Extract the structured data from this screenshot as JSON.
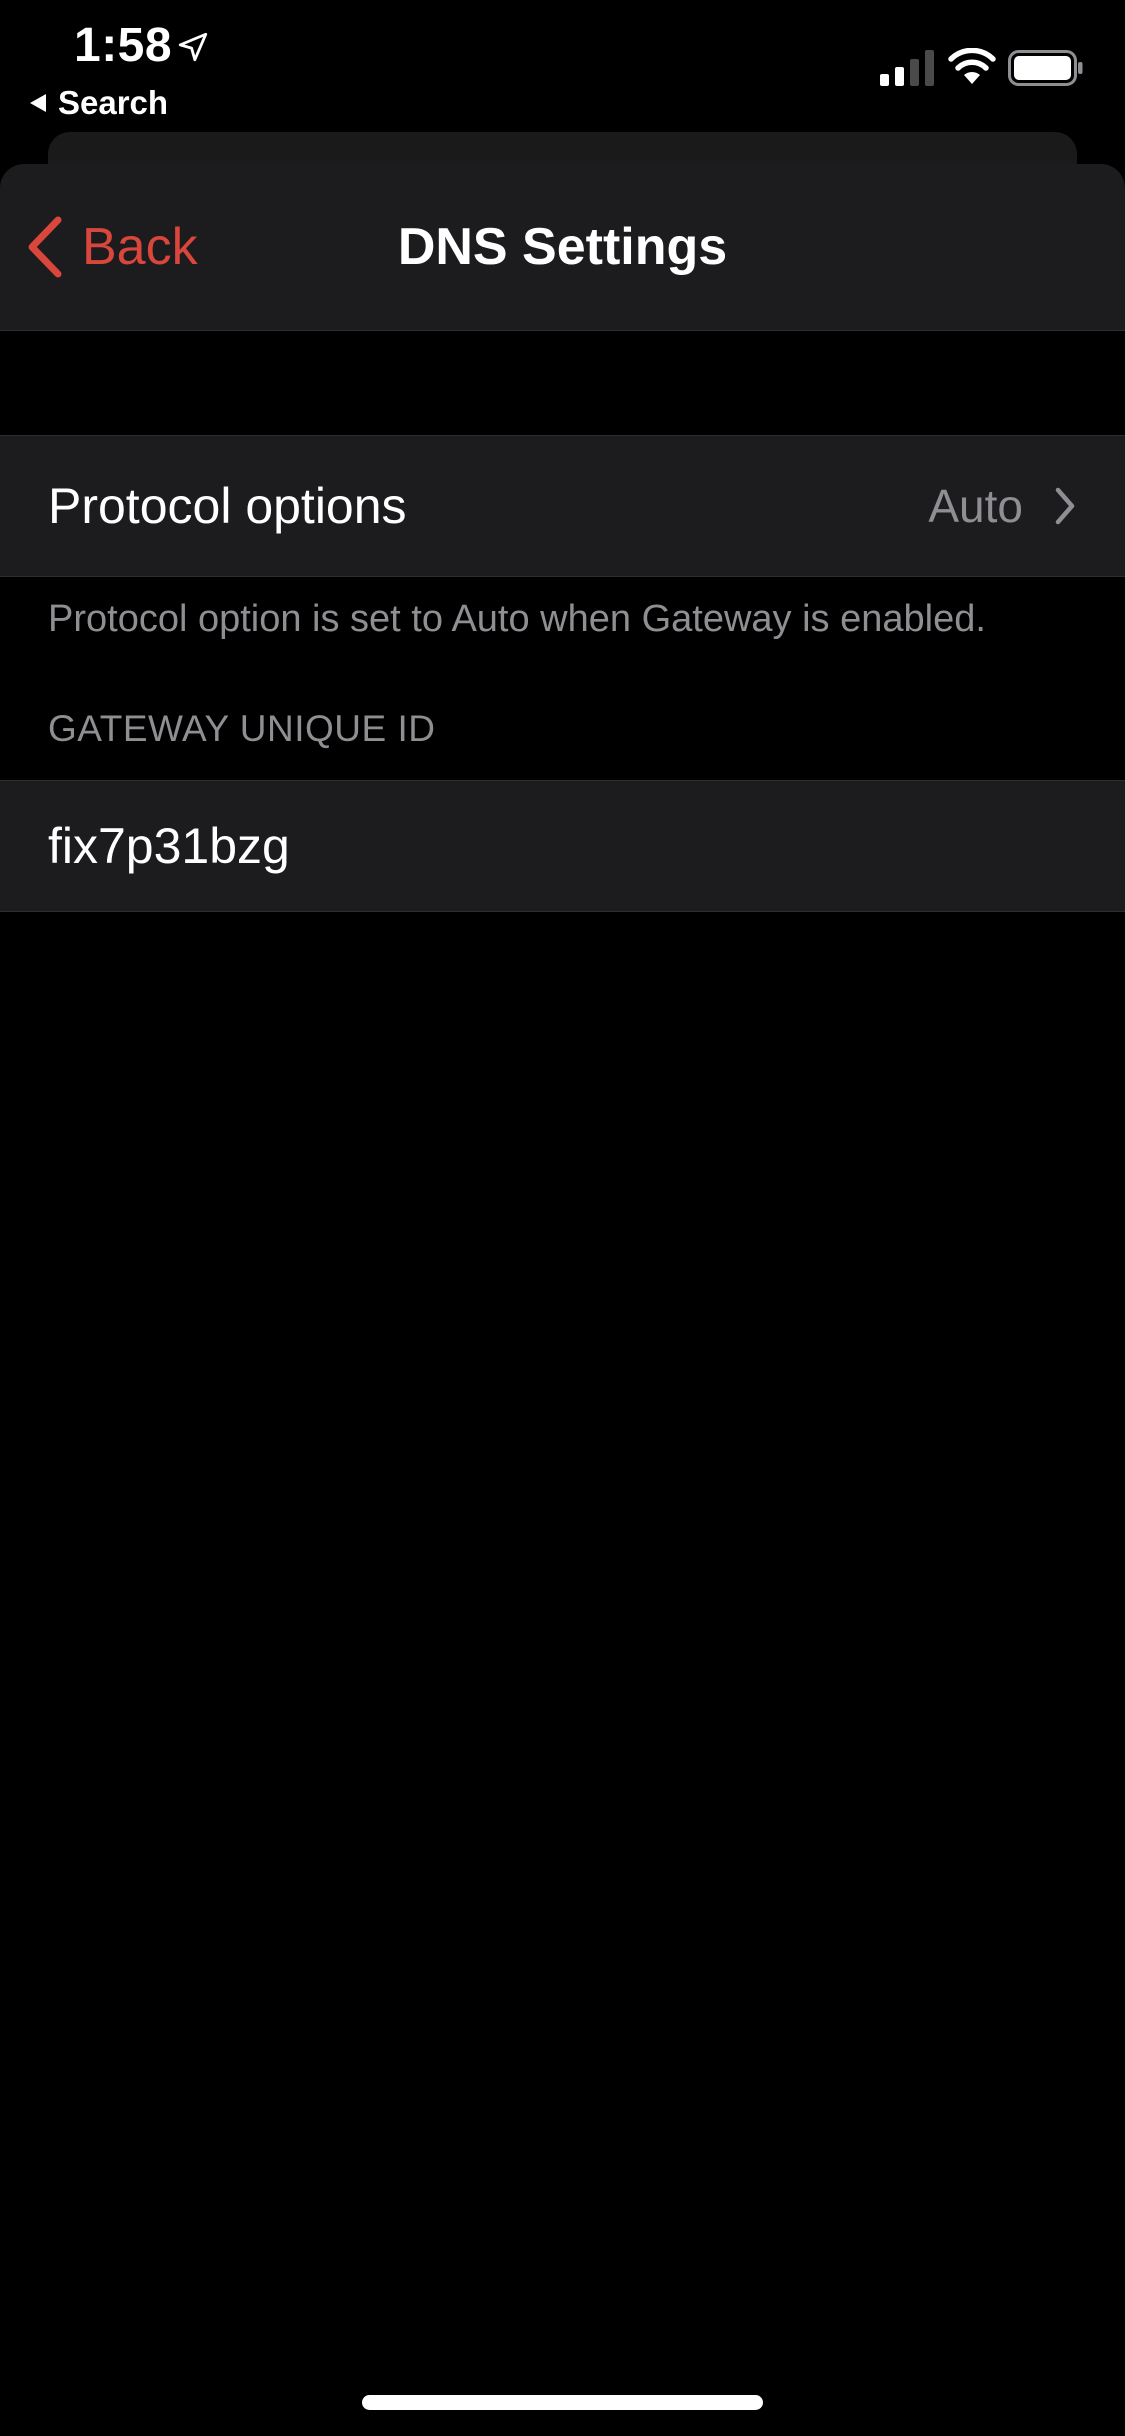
{
  "status_bar": {
    "time": "1:58",
    "back_to_app": "Search",
    "icons": [
      "location-arrow-icon",
      "cellular-signal-icon",
      "wifi-icon",
      "battery-icon"
    ]
  },
  "nav": {
    "back_label": "Back",
    "title": "DNS Settings",
    "accent_color": "#d9463b"
  },
  "protocol_row": {
    "label": "Protocol options",
    "value": "Auto"
  },
  "protocol_footer": "Protocol option is set to Auto when Gateway is enabled.",
  "gateway_section": {
    "header": "GATEWAY UNIQUE ID",
    "value": "fix7p31bzg"
  },
  "colors": {
    "background": "#000000",
    "cell": "#1c1c1e",
    "secondary_text": "#8e8e93"
  }
}
